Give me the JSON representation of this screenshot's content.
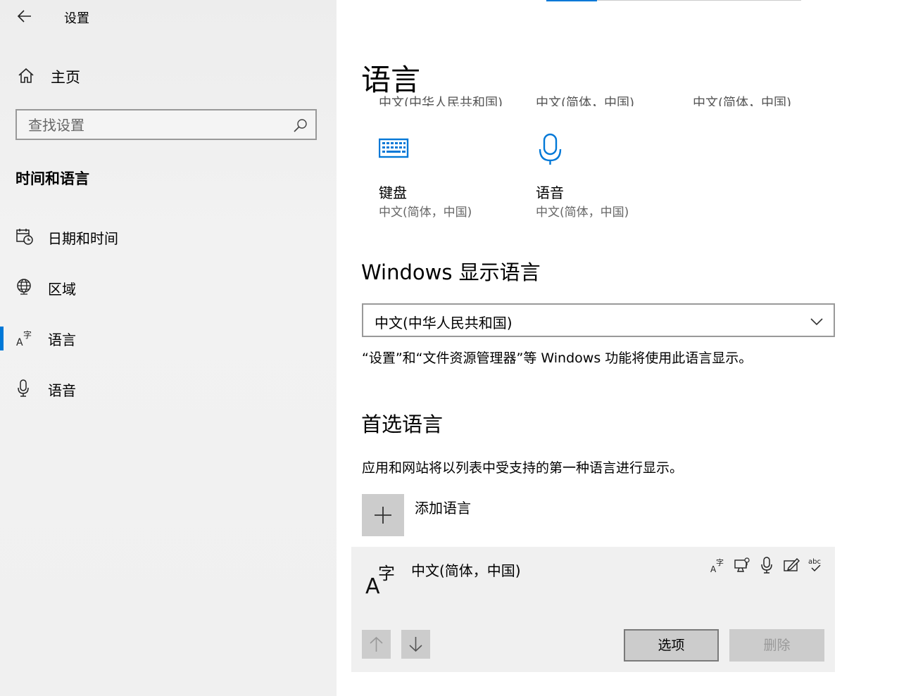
{
  "app": {
    "title": "设置"
  },
  "sidebar": {
    "home_label": "主页",
    "search_placeholder": "查找设置",
    "section_title": "时间和语言",
    "items": [
      {
        "label": "日期和时间",
        "icon": "calendar-clock-icon",
        "active": false
      },
      {
        "label": "区域",
        "icon": "globe-icon",
        "active": false
      },
      {
        "label": "语言",
        "icon": "language-icon",
        "active": true
      },
      {
        "label": "语音",
        "icon": "microphone-icon",
        "active": false
      }
    ]
  },
  "main": {
    "page_title": "语言",
    "clipped_row": [
      "中文(中华人民共和国)",
      "中文(简体，中国)",
      "中文(简体，中国)"
    ],
    "tiles": [
      {
        "title": "键盘",
        "subtitle": "中文(简体，中国)",
        "icon": "keyboard-icon"
      },
      {
        "title": "语音",
        "subtitle": "中文(简体，中国)",
        "icon": "microphone-icon"
      }
    ],
    "display_language": {
      "heading": "Windows 显示语言",
      "selected": "中文(中华人民共和国)",
      "description": "“设置”和“文件资源管理器”等 Windows 功能将使用此语言显示。"
    },
    "preferred": {
      "heading": "首选语言",
      "description": "应用和网站将以列表中受支持的第一种语言进行显示。",
      "add_label": "添加语言",
      "language": {
        "name": "中文(简体，中国)",
        "features": [
          "display-language-icon",
          "text-to-speech-icon",
          "speech-recognition-icon",
          "handwriting-icon",
          "spell-check-icon"
        ],
        "spell_text": "abc"
      },
      "options_label": "选项",
      "remove_label": "删除"
    }
  },
  "colors": {
    "accent": "#0078d7",
    "sidebar_bg": "#f0f0f0",
    "button_gray": "#cccccc"
  }
}
